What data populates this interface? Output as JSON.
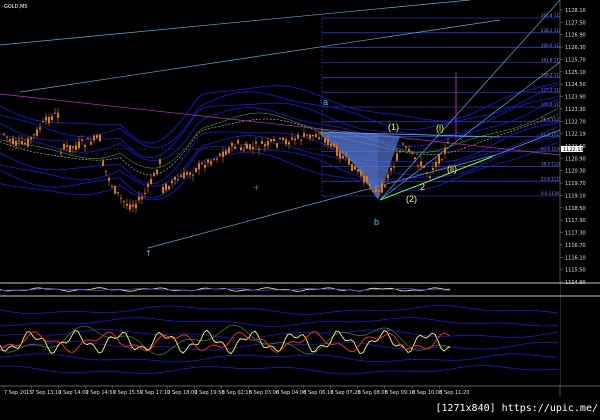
{
  "window": {
    "symbol_title": "GOLD,M5"
  },
  "price_axis": {
    "labels": [
      "1128.10",
      "1127.50",
      "1126.90",
      "1126.30",
      "1125.70",
      "1125.10",
      "1124.50",
      "1123.90",
      "1123.30",
      "1122.70",
      "1122.19",
      "1121.50",
      "1120.90",
      "1120.30",
      "1119.70",
      "1119.10",
      "1118.50",
      "1117.90",
      "1117.30",
      "1116.70",
      "1116.10",
      "1115.50",
      "1114.90"
    ],
    "current_price": "1122.19"
  },
  "time_axis": {
    "labels": [
      "7 Sep 2015",
      "7 Sep 13:10",
      "7 Sep 14:00",
      "7 Sep 14:50",
      "7 Sep 15:50",
      "7 Sep 17:10",
      "7 Sep 18:00",
      "7 Sep 19:50",
      "8 Sep 02:10",
      "8 Sep 03:00",
      "8 Sep 04:00",
      "8 Sep 06:10",
      "8 Sep 07:20",
      "8 Sep 08:00",
      "8 Sep 09:10",
      "8 Sep 10:00",
      "8 Sep 11:20"
    ]
  },
  "fibonacci": {
    "levels": [
      "261.8 1127.60",
      "238.2 1126.80",
      "200.0 1125.60",
      "161.8 1124.20",
      "138.2 1123.60",
      "127.2 1123.20",
      "100.0 1122.60",
      "76.4 1121.80",
      "61.8 1121.30",
      "50.0 1120.90",
      "38.2 1120.40",
      "23.6 1119.90",
      "0.0 1119.20"
    ]
  },
  "wave_labels": {
    "a": "a",
    "b": "b",
    "w1": "(1)",
    "w2": "(2)",
    "wi": "(i)",
    "wii": "(ii)",
    "w2_small": "2"
  },
  "indicator_panes": {
    "pane1_label": "",
    "pane2_label": ""
  },
  "colors": {
    "background": "#000000",
    "candle_up": "#e07a10",
    "candle_down": "#e07a10",
    "band_blue": "#1a1ad8",
    "trendline_cyan": "#4fb0d8",
    "fib_blue": "#3a4dff",
    "harmonic_fill": "#5a7fe0",
    "magenta": "#c030c0",
    "yellow_osc": "#ffff40",
    "red_osc": "#ff3030",
    "wave_text": "#ffff40",
    "label_cyan": "#40c0ff"
  },
  "watermark": "[1271x840] https://upic.me/"
}
